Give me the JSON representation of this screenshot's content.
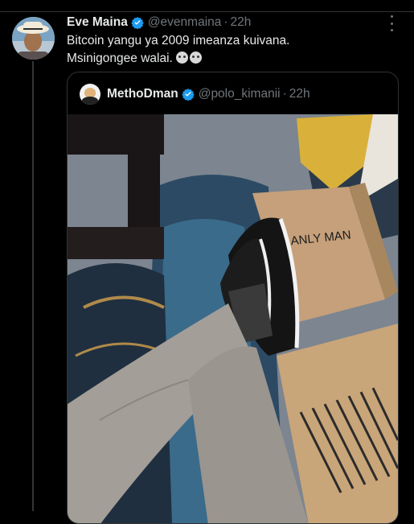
{
  "tweet": {
    "author_name": "Eve Maina",
    "handle": "@evenmaina",
    "separator": "·",
    "time": "22h",
    "text_line1": "Bitcoin yangu ya 2009 imeanza kuivana.",
    "text_line2": "Msinigongee walai.",
    "emojis": [
      "skull-emoji",
      "skull-emoji"
    ]
  },
  "quoted_tweet": {
    "author_name": "MethoDman",
    "handle": "@polo_kimanii",
    "separator": "·",
    "time": "22h",
    "photo_bag_text": "ANLY MAN"
  },
  "colors": {
    "background": "#000000",
    "text_primary": "#e7e9ea",
    "text_secondary": "#71767b",
    "verified": "#1d9bf0",
    "border": "#2f3336"
  }
}
